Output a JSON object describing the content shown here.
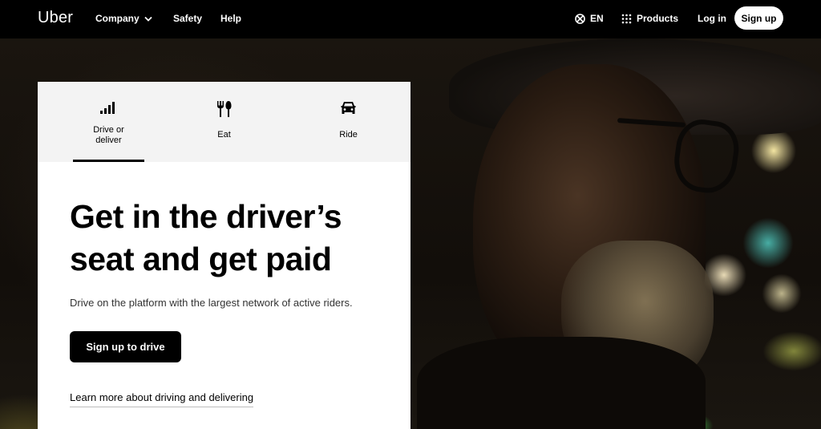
{
  "nav": {
    "logo": "Uber",
    "links": [
      {
        "label": "Company",
        "icon": "chevron-down-icon"
      },
      {
        "label": "Safety"
      },
      {
        "label": "Help"
      }
    ],
    "language": {
      "label": "EN",
      "icon": "globe-icon"
    },
    "products": {
      "label": "Products",
      "icon": "grid-dots-icon"
    },
    "login_label": "Log in",
    "signup_label": "Sign up"
  },
  "card": {
    "tabs": [
      {
        "label": "Drive or deliver",
        "icon": "signal-bars-icon",
        "active": true
      },
      {
        "label": "Eat",
        "icon": "fork-knife-icon",
        "active": false
      },
      {
        "label": "Ride",
        "icon": "car-icon",
        "active": false
      }
    ],
    "headline": "Get in the driver’s seat and get paid",
    "subline": "Drive on the platform with the largest network of active riders.",
    "cta_label": "Sign up to drive",
    "learn_link": "Learn more about driving and delivering"
  },
  "colors": {
    "nav_bg": "#000000",
    "card_bg": "#ffffff",
    "tab_bar_bg": "#f3f3f3",
    "primary_button": "#000000"
  }
}
